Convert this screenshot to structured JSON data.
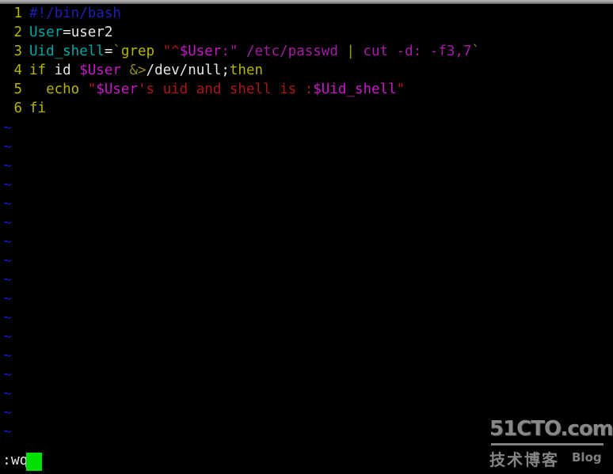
{
  "app": {
    "name": "vim",
    "mode": "command",
    "filetype": "bash"
  },
  "editor": {
    "background_color": "#000000",
    "line_number_color": "#b5b500",
    "tilde_color": "#1515d6",
    "tilde_char": "~",
    "tilde_count": 17,
    "lines": [
      {
        "number": "1",
        "text": "#!/bin/bash",
        "tokens": [
          {
            "t": "#!/bin/bash",
            "c": "c-comment"
          }
        ]
      },
      {
        "number": "2",
        "text": "User=user2",
        "tokens": [
          {
            "t": "User",
            "c": "c-ident"
          },
          {
            "t": "=user2",
            "c": "c-white"
          }
        ]
      },
      {
        "number": "3",
        "text": "Uid_shell=`grep \"^$User:\" /etc/passwd | cut -d: -f3,7`",
        "tokens": [
          {
            "t": "Uid_shell",
            "c": "c-ident"
          },
          {
            "t": "=",
            "c": "c-white"
          },
          {
            "t": "`",
            "c": "c-backtick"
          },
          {
            "t": "grep ",
            "c": "c-cmd"
          },
          {
            "t": "\"^",
            "c": "c-string"
          },
          {
            "t": "$User",
            "c": "c-var"
          },
          {
            "t": ":\"",
            "c": "c-magenta"
          },
          {
            "t": " /etc/passwd ",
            "c": "c-magenta"
          },
          {
            "t": "|",
            "c": "c-pipe"
          },
          {
            "t": " cut -d: -f3,7",
            "c": "c-magenta"
          },
          {
            "t": "`",
            "c": "c-backtick"
          }
        ]
      },
      {
        "number": "4",
        "text": "if id $User &>/dev/null;then",
        "tokens": [
          {
            "t": "if ",
            "c": "c-keyword"
          },
          {
            "t": "id ",
            "c": "c-white"
          },
          {
            "t": "$User",
            "c": "c-var"
          },
          {
            "t": " ",
            "c": "c-white"
          },
          {
            "t": "&>",
            "c": "c-backtick"
          },
          {
            "t": "/dev/null;",
            "c": "c-white"
          },
          {
            "t": "then",
            "c": "c-keyword"
          }
        ]
      },
      {
        "number": "5",
        "text": "  echo \"$User's uid and shell is :$Uid_shell\"",
        "tokens": [
          {
            "t": "  ",
            "c": "c-white"
          },
          {
            "t": "echo ",
            "c": "c-keyword"
          },
          {
            "t": "\"",
            "c": "c-string"
          },
          {
            "t": "$User",
            "c": "c-var"
          },
          {
            "t": "'s uid and shell is :",
            "c": "c-string"
          },
          {
            "t": "$Uid_shell",
            "c": "c-var"
          },
          {
            "t": "\"",
            "c": "c-string"
          }
        ]
      },
      {
        "number": "6",
        "text": "fi",
        "tokens": [
          {
            "t": "fi",
            "c": "c-keyword"
          }
        ]
      }
    ]
  },
  "statusline": {
    "command": ":wq",
    "cursor_color": "#00e000"
  },
  "watermark": {
    "main": "51CTO.com",
    "chinese": "技术博客",
    "blog": "Blog"
  }
}
